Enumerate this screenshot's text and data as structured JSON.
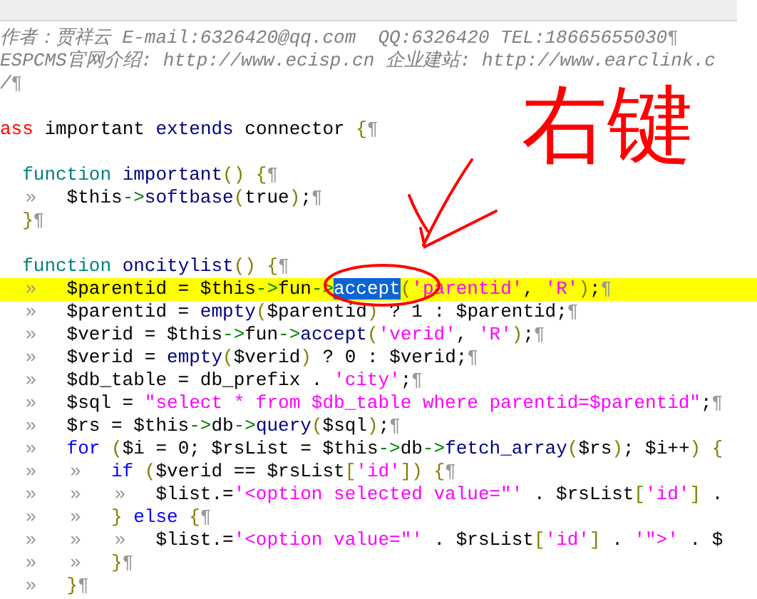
{
  "lines": [
    {
      "highlighted": false,
      "tokens": [
        {
          "kind": "comment",
          "text": "作者：贾祥云 E-mail:6326420@qq.com  QQ:6326420 TEL:18665655030"
        },
        {
          "kind": "eol",
          "text": "¶"
        }
      ]
    },
    {
      "highlighted": false,
      "tokens": [
        {
          "kind": "comment",
          "text": "ESPCMS官网介绍: http://www.ecisp.cn 企业建站: http://www.earclink.c"
        }
      ]
    },
    {
      "highlighted": false,
      "tokens": [
        {
          "kind": "comment",
          "text": "/"
        },
        {
          "kind": "eol",
          "text": "¶"
        }
      ]
    },
    {
      "highlighted": false
    },
    {
      "highlighted": false,
      "tokens": [
        {
          "kind": "red",
          "text": "ass"
        },
        {
          "kind": "plain",
          "text": " important "
        },
        {
          "kind": "name",
          "text": "extends"
        },
        {
          "kind": "plain",
          "text": " connector "
        },
        {
          "kind": "brace",
          "text": "{"
        },
        {
          "kind": "eol",
          "text": "¶"
        }
      ]
    },
    {
      "highlighted": false
    },
    {
      "highlighted": false,
      "tokens": [
        {
          "kind": "indent"
        },
        {
          "kind": "keyword",
          "text": "function"
        },
        {
          "kind": "name",
          "text": " important"
        },
        {
          "kind": "brace",
          "text": "() {"
        },
        {
          "kind": "eol",
          "text": "¶"
        }
      ]
    },
    {
      "highlighted": false,
      "tokens": [
        {
          "kind": "indent"
        },
        {
          "kind": "tab",
          "text": "»"
        },
        {
          "kind": "plain",
          "text": "$this"
        },
        {
          "kind": "arrow",
          "text": "->"
        },
        {
          "kind": "name",
          "text": "softbase"
        },
        {
          "kind": "brace",
          "text": "("
        },
        {
          "kind": "plain",
          "text": "true"
        },
        {
          "kind": "brace",
          "text": ")"
        },
        {
          "kind": "plain",
          "text": ";"
        },
        {
          "kind": "eol",
          "text": "¶"
        }
      ]
    },
    {
      "highlighted": false,
      "tokens": [
        {
          "kind": "indent"
        },
        {
          "kind": "brace",
          "text": "}"
        },
        {
          "kind": "eol",
          "text": "¶"
        }
      ]
    },
    {
      "highlighted": false
    },
    {
      "highlighted": false,
      "tokens": [
        {
          "kind": "indent"
        },
        {
          "kind": "keyword",
          "text": "function"
        },
        {
          "kind": "name",
          "text": " oncitylist"
        },
        {
          "kind": "brace",
          "text": "() {"
        },
        {
          "kind": "eol",
          "text": "¶"
        }
      ]
    },
    {
      "highlighted": true,
      "tokens": [
        {
          "kind": "indent"
        },
        {
          "kind": "tab",
          "text": "»"
        },
        {
          "kind": "plain",
          "text": "$parentid = $this"
        },
        {
          "kind": "arrow",
          "text": "->"
        },
        {
          "kind": "plain",
          "text": "fun"
        },
        {
          "kind": "arrow",
          "text": "->"
        },
        {
          "kind": "selection",
          "text": "accept"
        },
        {
          "kind": "brace",
          "text": "("
        },
        {
          "kind": "string",
          "text": "'parentid'"
        },
        {
          "kind": "plain",
          "text": ", "
        },
        {
          "kind": "string",
          "text": "'R'"
        },
        {
          "kind": "brace",
          "text": ")"
        },
        {
          "kind": "plain",
          "text": ";"
        },
        {
          "kind": "eol",
          "text": "¶"
        }
      ]
    },
    {
      "highlighted": false,
      "tokens": [
        {
          "kind": "indent"
        },
        {
          "kind": "tab",
          "text": "»"
        },
        {
          "kind": "plain",
          "text": "$parentid = "
        },
        {
          "kind": "name",
          "text": "empty"
        },
        {
          "kind": "brace",
          "text": "("
        },
        {
          "kind": "plain",
          "text": "$parentid"
        },
        {
          "kind": "brace",
          "text": ")"
        },
        {
          "kind": "plain",
          "text": " ? 1 : $parentid;"
        },
        {
          "kind": "eol",
          "text": "¶"
        }
      ]
    },
    {
      "highlighted": false,
      "tokens": [
        {
          "kind": "indent"
        },
        {
          "kind": "tab",
          "text": "»"
        },
        {
          "kind": "plain",
          "text": "$verid = $this"
        },
        {
          "kind": "arrow",
          "text": "->"
        },
        {
          "kind": "plain",
          "text": "fun"
        },
        {
          "kind": "arrow",
          "text": "->"
        },
        {
          "kind": "name",
          "text": "accept"
        },
        {
          "kind": "brace",
          "text": "("
        },
        {
          "kind": "string",
          "text": "'verid'"
        },
        {
          "kind": "plain",
          "text": ", "
        },
        {
          "kind": "string",
          "text": "'R'"
        },
        {
          "kind": "brace",
          "text": ")"
        },
        {
          "kind": "plain",
          "text": ";"
        },
        {
          "kind": "eol",
          "text": "¶"
        }
      ]
    },
    {
      "highlighted": false,
      "tokens": [
        {
          "kind": "indent"
        },
        {
          "kind": "tab",
          "text": "»"
        },
        {
          "kind": "plain",
          "text": "$verid = "
        },
        {
          "kind": "name",
          "text": "empty"
        },
        {
          "kind": "brace",
          "text": "("
        },
        {
          "kind": "plain",
          "text": "$verid"
        },
        {
          "kind": "brace",
          "text": ")"
        },
        {
          "kind": "plain",
          "text": " ? 0 : $verid;"
        },
        {
          "kind": "eol",
          "text": "¶"
        }
      ]
    },
    {
      "highlighted": false,
      "tokens": [
        {
          "kind": "indent"
        },
        {
          "kind": "tab",
          "text": "»"
        },
        {
          "kind": "plain",
          "text": "$db_table = db_prefix . "
        },
        {
          "kind": "string",
          "text": "'city'"
        },
        {
          "kind": "plain",
          "text": ";"
        },
        {
          "kind": "eol",
          "text": "¶"
        }
      ]
    },
    {
      "highlighted": false,
      "tokens": [
        {
          "kind": "indent"
        },
        {
          "kind": "tab",
          "text": "»"
        },
        {
          "kind": "plain",
          "text": "$sql = "
        },
        {
          "kind": "string",
          "text": "\"select * from $db_table where parentid=$parentid\""
        },
        {
          "kind": "plain",
          "text": ";"
        },
        {
          "kind": "eol",
          "text": "¶"
        }
      ]
    },
    {
      "highlighted": false,
      "tokens": [
        {
          "kind": "indent"
        },
        {
          "kind": "tab",
          "text": "»"
        },
        {
          "kind": "plain",
          "text": "$rs = $this"
        },
        {
          "kind": "arrow",
          "text": "->"
        },
        {
          "kind": "plain",
          "text": "db"
        },
        {
          "kind": "arrow",
          "text": "->"
        },
        {
          "kind": "name",
          "text": "query"
        },
        {
          "kind": "brace",
          "text": "("
        },
        {
          "kind": "plain",
          "text": "$sql"
        },
        {
          "kind": "brace",
          "text": ")"
        },
        {
          "kind": "plain",
          "text": ";"
        },
        {
          "kind": "eol",
          "text": "¶"
        }
      ]
    },
    {
      "highlighted": false,
      "tokens": [
        {
          "kind": "indent"
        },
        {
          "kind": "tab",
          "text": "»"
        },
        {
          "kind": "control",
          "text": "for"
        },
        {
          "kind": "brace",
          "text": " ("
        },
        {
          "kind": "plain",
          "text": "$i = 0; $rsList = $this"
        },
        {
          "kind": "arrow",
          "text": "->"
        },
        {
          "kind": "plain",
          "text": "db"
        },
        {
          "kind": "arrow",
          "text": "->"
        },
        {
          "kind": "name",
          "text": "fetch_array"
        },
        {
          "kind": "brace",
          "text": "("
        },
        {
          "kind": "plain",
          "text": "$rs"
        },
        {
          "kind": "brace",
          "text": ")"
        },
        {
          "kind": "plain",
          "text": "; $i++"
        },
        {
          "kind": "brace",
          "text": ") {"
        }
      ]
    },
    {
      "highlighted": false,
      "tokens": [
        {
          "kind": "indent"
        },
        {
          "kind": "tab",
          "text": "»"
        },
        {
          "kind": "tab",
          "text": "»"
        },
        {
          "kind": "control",
          "text": "if"
        },
        {
          "kind": "brace",
          "text": " ("
        },
        {
          "kind": "plain",
          "text": "$verid == $rsList"
        },
        {
          "kind": "brace",
          "text": "["
        },
        {
          "kind": "string",
          "text": "'id'"
        },
        {
          "kind": "brace",
          "text": "]) {"
        },
        {
          "kind": "eol",
          "text": "¶"
        }
      ]
    },
    {
      "highlighted": false,
      "tokens": [
        {
          "kind": "indent"
        },
        {
          "kind": "tab",
          "text": "»"
        },
        {
          "kind": "tab",
          "text": "»"
        },
        {
          "kind": "tab",
          "text": "»"
        },
        {
          "kind": "plain",
          "text": "$list.="
        },
        {
          "kind": "string",
          "text": "'<option selected value=\"'"
        },
        {
          "kind": "plain",
          "text": " . $rsList"
        },
        {
          "kind": "brace",
          "text": "["
        },
        {
          "kind": "string",
          "text": "'id'"
        },
        {
          "kind": "brace",
          "text": "]"
        },
        {
          "kind": "plain",
          "text": " ."
        }
      ]
    },
    {
      "highlighted": false,
      "tokens": [
        {
          "kind": "indent"
        },
        {
          "kind": "tab",
          "text": "»"
        },
        {
          "kind": "tab",
          "text": "»"
        },
        {
          "kind": "brace",
          "text": "}"
        },
        {
          "kind": "control",
          "text": " else"
        },
        {
          "kind": "brace",
          "text": " {"
        },
        {
          "kind": "eol",
          "text": "¶"
        }
      ]
    },
    {
      "highlighted": false,
      "tokens": [
        {
          "kind": "indent"
        },
        {
          "kind": "tab",
          "text": "»"
        },
        {
          "kind": "tab",
          "text": "»"
        },
        {
          "kind": "tab",
          "text": "»"
        },
        {
          "kind": "plain",
          "text": "$list.="
        },
        {
          "kind": "string",
          "text": "'<option value=\"'"
        },
        {
          "kind": "plain",
          "text": " . $rsList"
        },
        {
          "kind": "brace",
          "text": "["
        },
        {
          "kind": "string",
          "text": "'id'"
        },
        {
          "kind": "brace",
          "text": "]"
        },
        {
          "kind": "plain",
          "text": " . "
        },
        {
          "kind": "string",
          "text": "'\">'"
        },
        {
          "kind": "plain",
          "text": " . $"
        }
      ]
    },
    {
      "highlighted": false,
      "tokens": [
        {
          "kind": "indent"
        },
        {
          "kind": "tab",
          "text": "»"
        },
        {
          "kind": "tab",
          "text": "»"
        },
        {
          "kind": "brace",
          "text": "}"
        },
        {
          "kind": "eol",
          "text": "¶"
        }
      ]
    },
    {
      "highlighted": false,
      "tokens": [
        {
          "kind": "indent"
        },
        {
          "kind": "tab",
          "text": "»"
        },
        {
          "kind": "brace",
          "text": "}"
        },
        {
          "kind": "eol",
          "text": "¶"
        }
      ]
    }
  ],
  "annotation": {
    "note": "右键"
  }
}
